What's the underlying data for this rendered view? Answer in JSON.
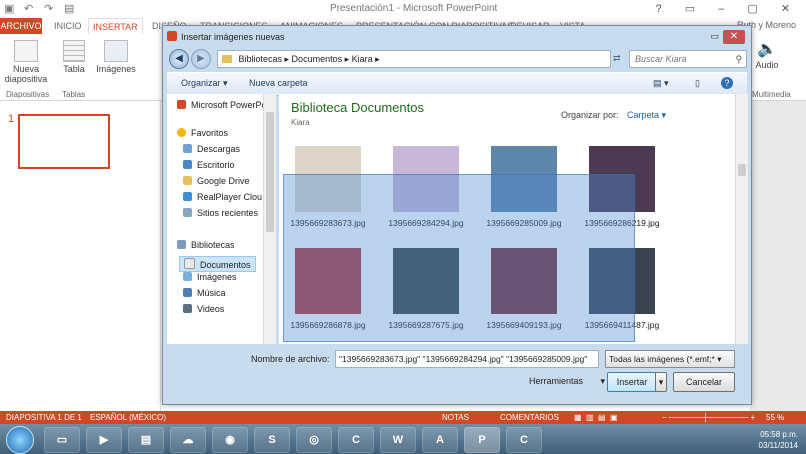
{
  "app": {
    "title": "Presentación1 - Microsoft PowerPoint",
    "user": "Ruth y Moreno"
  },
  "ribbon": {
    "tabs": [
      "ARCHIVO",
      "INICIO",
      "INSERTAR",
      "DISEÑO",
      "TRANSICIONES",
      "ANIMACIONES",
      "PRESENTACIÓN CON DIAPOSITIVAS",
      "REVISAR",
      "VISTA"
    ],
    "nueva_diapositiva": "Nueva diapositiva",
    "tabla": "Tabla",
    "imagenes": "Imágenes",
    "group_diapositivas": "Diapositivas",
    "group_tablas": "Tablas",
    "audio": "Audio",
    "group_media": "Multimedia"
  },
  "slides": {
    "num": "1"
  },
  "dialog": {
    "title": "Insertar imágenes nuevas",
    "breadcrumb": "Bibliotecas  ▸  Documentos  ▸  Kiara  ▸",
    "search_placeholder": "Buscar Kiara",
    "organize": "Organizar ▾",
    "new_folder": "Nueva carpeta",
    "nav": {
      "ppt": "Microsoft PowerPo",
      "favorites_header": "Favoritos",
      "favorites": [
        "Descargas",
        "Escritorio",
        "Google Drive",
        "RealPlayer Clou",
        "Sitios recientes"
      ],
      "libraries_header": "Bibliotecas",
      "libraries": [
        "Documentos",
        "Imágenes",
        "Música",
        "Videos"
      ]
    },
    "library_title": "Biblioteca Documentos",
    "library_sub": "Kiara",
    "organize_by_label": "Organizar por:",
    "organize_by_value": "Carpeta ▾",
    "files": [
      {
        "name": "1395669283673.jpg",
        "color": "#ddd6c8"
      },
      {
        "name": "1395669284294.jpg",
        "color": "#c8b8d6"
      },
      {
        "name": "1395669285009.jpg",
        "color": "#5d86aa"
      },
      {
        "name": "1395669286219.jpg",
        "color": "#4b3a52"
      },
      {
        "name": "1395669286878.jpg",
        "color": "#b03a3a"
      },
      {
        "name": "1395669287675.jpg",
        "color": "#3d4a44"
      },
      {
        "name": "1395669409193.jpg",
        "color": "#7a3438"
      },
      {
        "name": "1395669411487.jpg",
        "color": "#3b4350"
      }
    ],
    "file_name_label": "Nombre de archivo:",
    "file_name_value": "\"1395669283673.jpg\" \"1395669284294.jpg\" \"1395669285009.jpg\"",
    "file_type": "Todas las imágenes (*.emf;* ▾",
    "tools": "Herramientas",
    "insert": "Insertar",
    "cancel": "Cancelar"
  },
  "status": {
    "slide": "DIAPOSITIVA 1 DE 1",
    "language": "ESPAÑOL (MÉXICO)",
    "notes": "NOTAS",
    "comments": "COMENTARIOS",
    "zoom": "55 %"
  },
  "taskbar": {
    "time": "05:58 p.m.",
    "date": "03/11/2014"
  }
}
